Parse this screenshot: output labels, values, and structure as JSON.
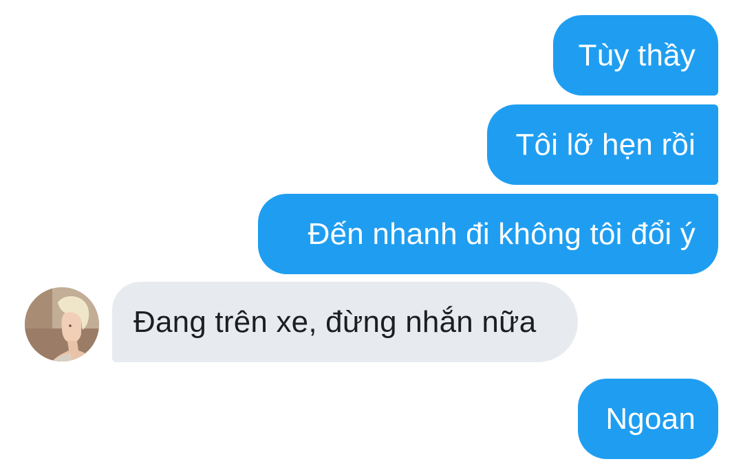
{
  "conversation": {
    "messages": [
      {
        "direction": "outgoing",
        "text": "Tùy thầy"
      },
      {
        "direction": "outgoing",
        "text": "Tôi lỡ hẹn rồi"
      },
      {
        "direction": "outgoing",
        "text": "Đến nhanh đi không tôi đổi ý"
      },
      {
        "direction": "incoming",
        "text": "Đang trên xe, đừng nhắn nữa"
      },
      {
        "direction": "outgoing",
        "text": "Ngoan"
      }
    ],
    "colors": {
      "outgoing_bubble": "#1f9ef1",
      "outgoing_text": "#ffffff",
      "incoming_bubble": "#e7ebf0",
      "incoming_text": "#1c1e21",
      "background": "#ffffff"
    }
  }
}
